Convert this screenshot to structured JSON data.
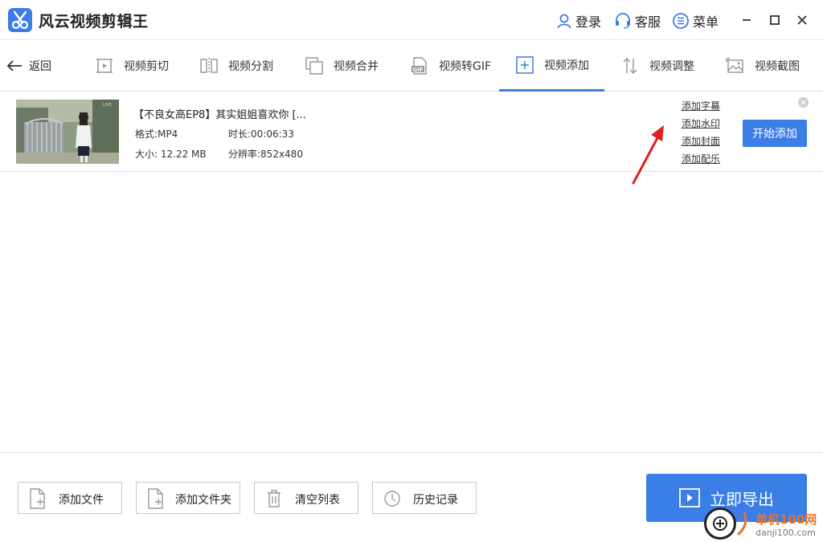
{
  "app": {
    "title": "风云视频剪辑王",
    "brand_color": "#3a7ee6"
  },
  "header": {
    "login_label": "登录",
    "service_label": "客服",
    "menu_label": "菜单"
  },
  "toolbar": {
    "back_label": "返回",
    "tools": [
      {
        "label": "视频剪切",
        "icon": "video-cut-icon"
      },
      {
        "label": "视频分割",
        "icon": "video-split-icon"
      },
      {
        "label": "视频合并",
        "icon": "video-merge-icon"
      },
      {
        "label": "视频转GIF",
        "icon": "gif-icon"
      },
      {
        "label": "视频添加",
        "icon": "plus-square-icon",
        "active": true
      },
      {
        "label": "视频调整",
        "icon": "adjust-arrows-icon"
      },
      {
        "label": "视频截图",
        "icon": "screenshot-icon"
      }
    ]
  },
  "file": {
    "title": "【不良女高EP8】其实姐姐喜欢你 [...",
    "format": "格式:MP4",
    "duration": "时长:00:06:33",
    "size": "大小: 12.22 MB",
    "resolution": "分辨率:852x480",
    "links": [
      "添加字幕",
      "添加水印",
      "添加封面",
      "添加配乐"
    ],
    "start_label": "开始添加"
  },
  "bottom": {
    "add_file": "添加文件",
    "add_folder": "添加文件夹",
    "clear_list": "清空列表",
    "history": "历史记录",
    "export": "立即导出"
  },
  "watermark": {
    "site": "单机100网",
    "domain": "danji100.com"
  }
}
